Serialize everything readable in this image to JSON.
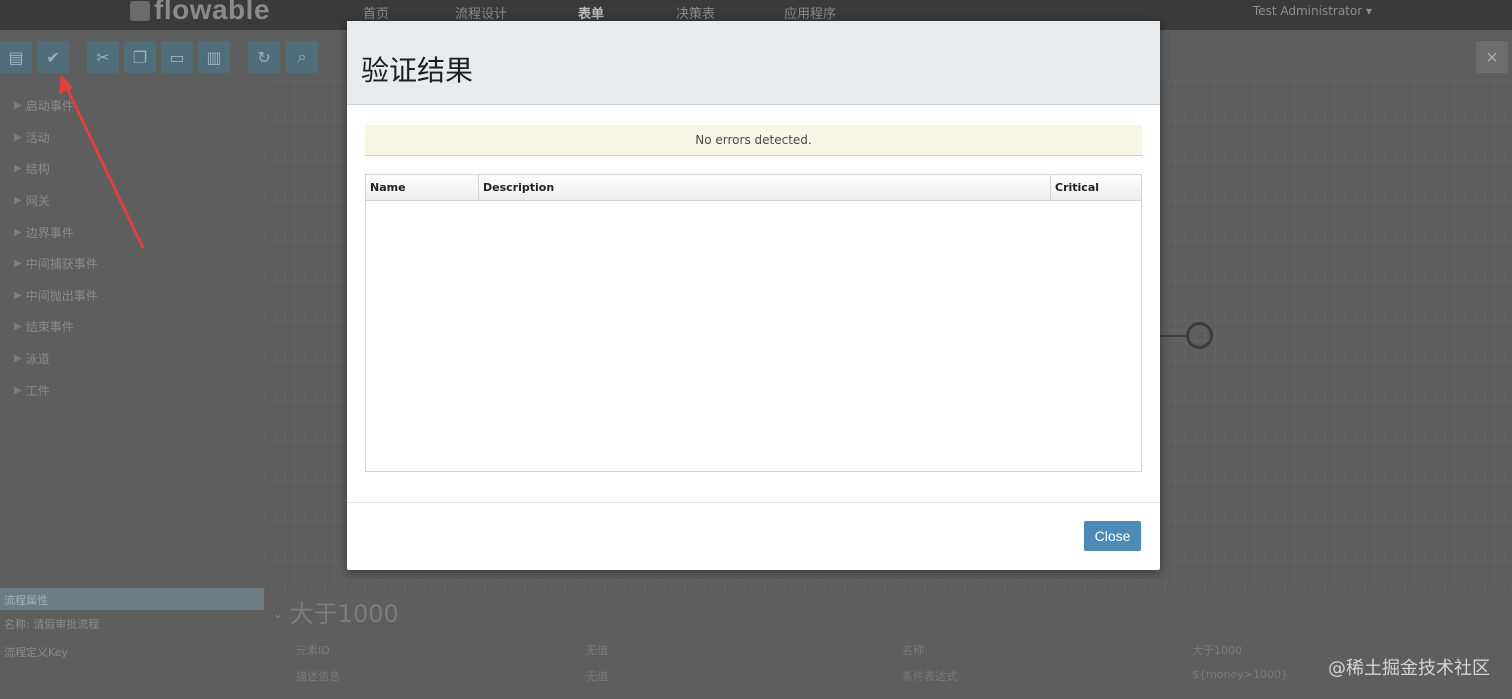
{
  "app": {
    "logo_text": "flowable",
    "nav": [
      "首页",
      "流程设计",
      "表单",
      "决策表",
      "应用程序"
    ],
    "active_nav_index": 2,
    "user": "Test Administrator ▾"
  },
  "palette": {
    "items": [
      "启动事件",
      "活动",
      "结构",
      "网关",
      "边界事件",
      "中间捕获事件",
      "中间抛出事件",
      "结束事件",
      "泳道",
      "工件"
    ]
  },
  "properties": {
    "section_header": "流程属性",
    "left_lines": [
      "名称: 请假审批流程",
      "流程定义Key"
    ],
    "title": "大于1000",
    "rows": [
      [
        "元素ID",
        "无值",
        "名称",
        "大于1000"
      ],
      [
        "描述信息",
        "无值",
        "条件表达式",
        "${money>1000}"
      ]
    ]
  },
  "modal": {
    "title": "验证结果",
    "alert_text": "No errors detected.",
    "columns": [
      "Name",
      "Description",
      "Critical"
    ],
    "rows": [],
    "close_label": "Close"
  },
  "watermark": "@稀土掘金技术社区",
  "colors": {
    "overlay_bg": "#5e5e5e",
    "primary_button": "#4d8ab5",
    "alert_bg": "#f5f6e3",
    "annotation_arrow": "#e0413a"
  },
  "icons": [
    "save-icon",
    "validate-icon",
    "cut-icon",
    "copy-icon",
    "paste-icon",
    "delete-icon",
    "zoom-in-icon",
    "close-icon",
    "caret-right-icon"
  ]
}
